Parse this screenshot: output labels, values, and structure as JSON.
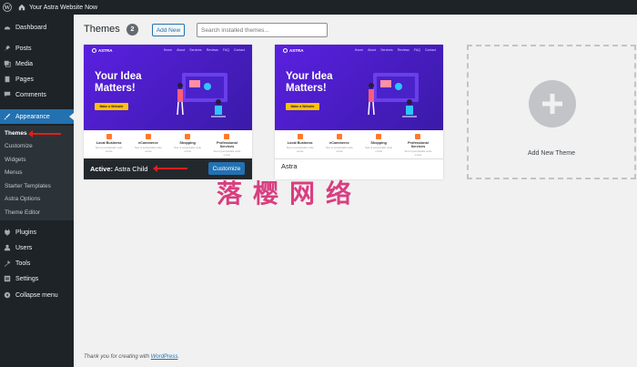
{
  "adminbar": {
    "site_title": "Your Astra Website Now"
  },
  "sidebar": {
    "items": [
      {
        "label": "Dashboard",
        "icon": "dashboard-icon"
      },
      {
        "label": "Posts",
        "icon": "pin-icon"
      },
      {
        "label": "Media",
        "icon": "media-icon"
      },
      {
        "label": "Pages",
        "icon": "pages-icon"
      },
      {
        "label": "Comments",
        "icon": "comments-icon"
      },
      {
        "label": "Appearance",
        "icon": "brush-icon",
        "current": true
      },
      {
        "label": "Plugins",
        "icon": "plugin-icon"
      },
      {
        "label": "Users",
        "icon": "users-icon"
      },
      {
        "label": "Tools",
        "icon": "wrench-icon"
      },
      {
        "label": "Settings",
        "icon": "settings-icon"
      },
      {
        "label": "Collapse menu",
        "icon": "collapse-icon"
      }
    ],
    "submenu": [
      "Themes",
      "Customize",
      "Widgets",
      "Menus",
      "Starter Templates",
      "Astra Options",
      "Theme Editor"
    ]
  },
  "header": {
    "title": "Themes",
    "count": "2",
    "add_new": "Add New",
    "search_placeholder": "Search installed themes..."
  },
  "preview": {
    "logo": "ASTRA",
    "nav": [
      "Home",
      "About",
      "Services",
      "Reviews",
      "FAQ",
      "Contact"
    ],
    "headline": "Your Idea Matters!",
    "button": "Make a Website",
    "features": [
      {
        "title": "Local Business",
        "desc": "Sed ut perspiciatis unde omnis"
      },
      {
        "title": "eCommerce",
        "desc": "Sed ut perspiciatis unde omnis"
      },
      {
        "title": "Shopping",
        "desc": "Sed ut perspiciatis unde omnis"
      },
      {
        "title": "Professional Services",
        "desc": "Sed ut perspiciatis unde omnis"
      }
    ]
  },
  "themes": [
    {
      "active_prefix": "Active:",
      "name": "Astra Child",
      "action": "Customize"
    },
    {
      "name": "Astra"
    }
  ],
  "add_new_theme": "Add New Theme",
  "footer": {
    "text": "Thank you for creating with",
    "link": "WordPress",
    "period": "."
  },
  "watermark": "落樱网络",
  "colors": {
    "admin_dark": "#1d2327",
    "accent": "#2271b1",
    "annotation_red": "#e0201a",
    "hero_purple": "#5a20e0"
  }
}
